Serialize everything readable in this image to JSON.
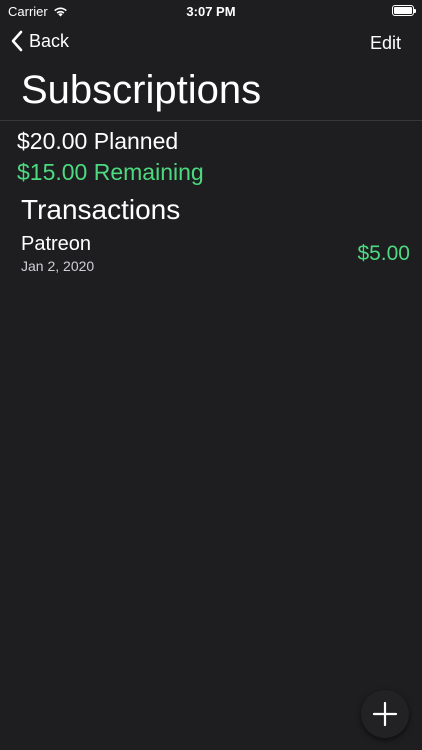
{
  "status_bar": {
    "carrier": "Carrier",
    "time": "3:07 PM",
    "wifi_icon": "wifi-icon",
    "battery_icon": "battery-icon"
  },
  "nav": {
    "back_label": "Back",
    "edit_label": "Edit"
  },
  "page": {
    "title": "Subscriptions"
  },
  "budget": {
    "planned": "$20.00 Planned",
    "remaining": "$15.00 Remaining"
  },
  "transactions": {
    "section_title": "Transactions",
    "items": [
      {
        "name": "Patreon",
        "date": "Jan 2, 2020",
        "amount": "$5.00"
      }
    ]
  },
  "actions": {
    "add_icon": "plus-icon"
  },
  "colors": {
    "background": "#1e1e20",
    "positive": "#4cd980",
    "text": "#ffffff"
  }
}
